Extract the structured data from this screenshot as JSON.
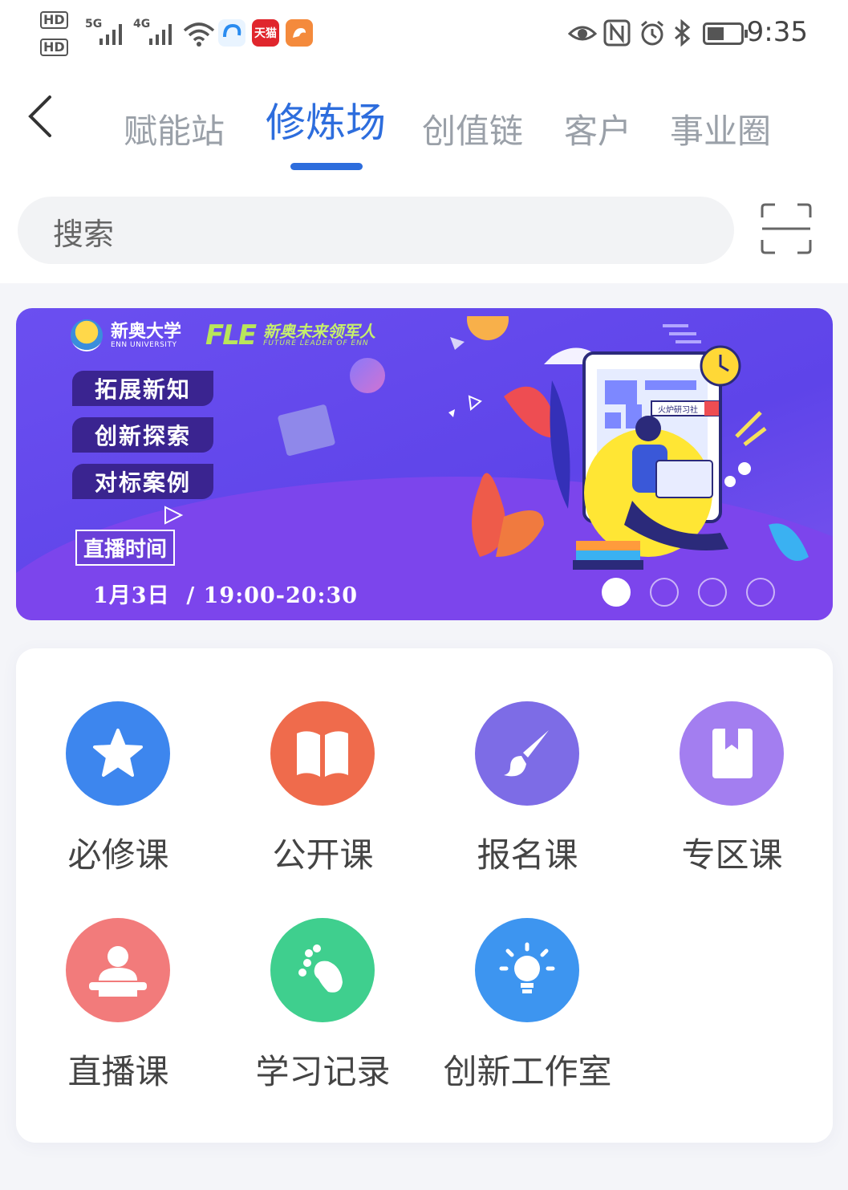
{
  "status_bar": {
    "hd1": "HD",
    "hd2": "HD",
    "net1": "5G",
    "net2": "4G",
    "tmall": "天猫",
    "time": "9:35"
  },
  "nav": {
    "back_icon": "chevron-left-icon",
    "tabs": [
      {
        "label": "赋能站",
        "active": false
      },
      {
        "label": "修炼场",
        "active": true
      },
      {
        "label": "创值链",
        "active": false
      },
      {
        "label": "客户",
        "active": false
      },
      {
        "label": "事业圈",
        "active": false
      }
    ],
    "accent": "#2d6ddd"
  },
  "search": {
    "placeholder": "搜索",
    "scan_icon": "scan-icon"
  },
  "banner": {
    "brand_cn": "新奥大学",
    "brand_en": "ENN UNIVERSITY",
    "fle": "FLE",
    "fle_cn": "新奥未来领军人",
    "fle_en": "FUTURE LEADER OF ENN",
    "tags": [
      "拓展新知",
      "创新探索",
      "对标案例"
    ],
    "live_label": "直播时间",
    "live_time": "1月3日  / 19:00-20:30",
    "illustration_tag": "火炉研习社",
    "pages": 4,
    "active_page": 1
  },
  "courses": [
    {
      "label": "必修课",
      "icon": "star-icon",
      "color": "#3d86ee"
    },
    {
      "label": "公开课",
      "icon": "open-book-icon",
      "color": "#ef6b4c"
    },
    {
      "label": "报名课",
      "icon": "paintbrush-icon",
      "color": "#7d6ce6"
    },
    {
      "label": "专区课",
      "icon": "bookmark-book-icon",
      "color": "#a37ef0"
    },
    {
      "label": "直播课",
      "icon": "presenter-icon",
      "color": "#f27b7b"
    },
    {
      "label": "学习记录",
      "icon": "footprint-icon",
      "color": "#3fcf8e"
    },
    {
      "label": "创新工作室",
      "icon": "lightbulb-icon",
      "color": "#3d95f0"
    }
  ]
}
